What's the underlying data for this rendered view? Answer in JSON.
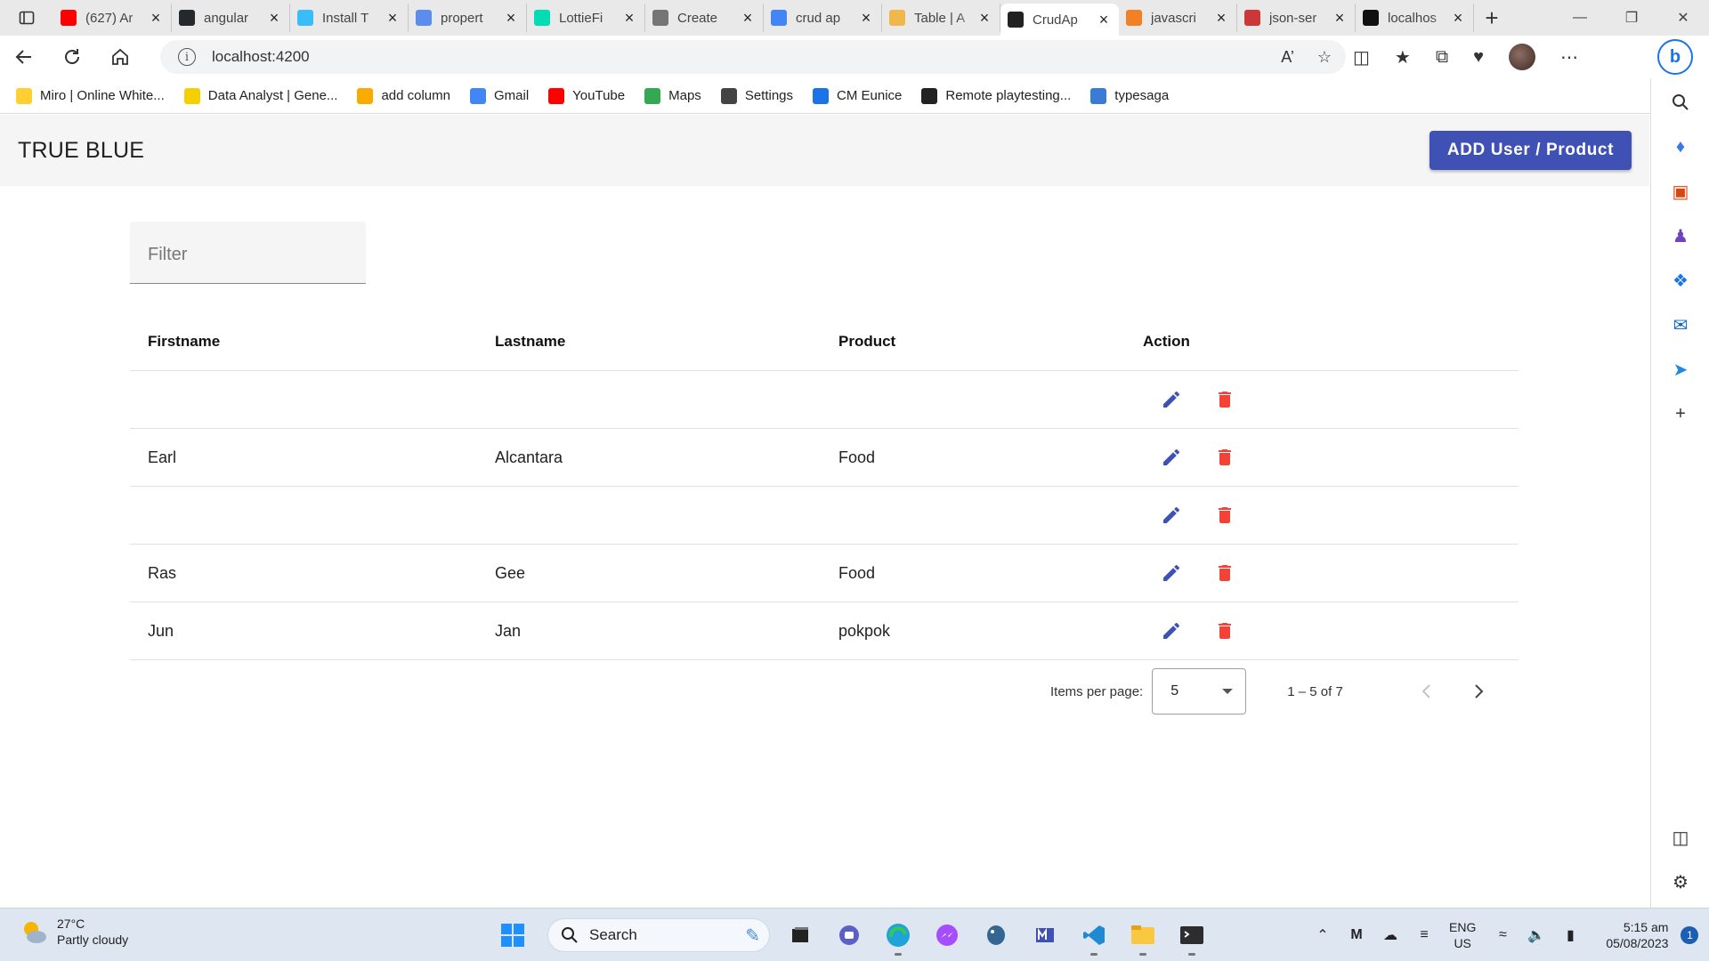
{
  "browser": {
    "tabs": [
      {
        "title": "(627) Ar",
        "icon": "youtube-icon",
        "color": "#ff0000"
      },
      {
        "title": "angular",
        "icon": "github-icon",
        "color": "#24292e"
      },
      {
        "title": "Install T",
        "icon": "tailwind-icon",
        "color": "#38bdf8"
      },
      {
        "title": "propert",
        "icon": "search-icon",
        "color": "#5b8def"
      },
      {
        "title": "LottieFi",
        "icon": "lottie-icon",
        "color": "#00ddb3"
      },
      {
        "title": "Create",
        "icon": "create-icon",
        "color": "#757575"
      },
      {
        "title": "crud ap",
        "icon": "google-icon",
        "color": "#4285f4"
      },
      {
        "title": "Table | A",
        "icon": "shield-icon",
        "color": "#f0b84a"
      },
      {
        "title": "CrudAp",
        "icon": "angular-icon",
        "color": "#222222",
        "active": true
      },
      {
        "title": "javascri",
        "icon": "stackoverflow-icon",
        "color": "#f48024"
      },
      {
        "title": "json-ser",
        "icon": "npm-icon",
        "color": "#cb3837"
      },
      {
        "title": "localhos",
        "icon": "angular-icon",
        "color": "#111111"
      }
    ],
    "url": "localhost:4200",
    "bookmarks": [
      {
        "label": "Miro | Online White...",
        "icon": "miro-icon",
        "color": "#ffd02f"
      },
      {
        "label": "Data Analyst | Gene...",
        "icon": "data-analyst-icon",
        "color": "#f5d000"
      },
      {
        "label": "add column",
        "icon": "bar-chart-icon",
        "color": "#f9ab00"
      },
      {
        "label": "Gmail",
        "icon": "google-icon",
        "color": "#4285f4"
      },
      {
        "label": "YouTube",
        "icon": "youtube-icon",
        "color": "#ff0000"
      },
      {
        "label": "Maps",
        "icon": "maps-icon",
        "color": "#34a853"
      },
      {
        "label": "Settings",
        "icon": "gear-icon",
        "color": "#444444"
      },
      {
        "label": "CM Eunice",
        "icon": "edge-icon",
        "color": "#1a73e8"
      },
      {
        "label": "Remote playtesting...",
        "icon": "playtest-icon",
        "color": "#222222"
      },
      {
        "label": "typesaga",
        "icon": "typesaga-icon",
        "color": "#3a7bd5"
      }
    ]
  },
  "app": {
    "title": "TRUE BLUE",
    "add_button": "ADD User / Product",
    "filter_placeholder": "Filter",
    "columns": [
      "Firstname",
      "Lastname",
      "Product",
      "Action"
    ],
    "rows": [
      {
        "firstname": "",
        "lastname": "",
        "product": ""
      },
      {
        "firstname": "Earl",
        "lastname": "Alcantara",
        "product": "Food"
      },
      {
        "firstname": "",
        "lastname": "",
        "product": ""
      },
      {
        "firstname": "Ras",
        "lastname": "Gee",
        "product": "Food"
      },
      {
        "firstname": "Jun",
        "lastname": "Jan",
        "product": "pokpok"
      }
    ],
    "paginator": {
      "items_per_page_label": "Items per page:",
      "items_per_page": "5",
      "range_label": "1 – 5 of 7"
    },
    "colors": {
      "primary": "#3f51b5",
      "warn": "#f44336",
      "header_bg": "#f5f5f5"
    }
  },
  "taskbar": {
    "weather_temp": "27°C",
    "weather_desc": "Partly cloudy",
    "search_label": "Search",
    "lang_top": "ENG",
    "lang_bottom": "US",
    "time": "5:15 am",
    "date": "05/08/2023",
    "notification_count": "1"
  }
}
